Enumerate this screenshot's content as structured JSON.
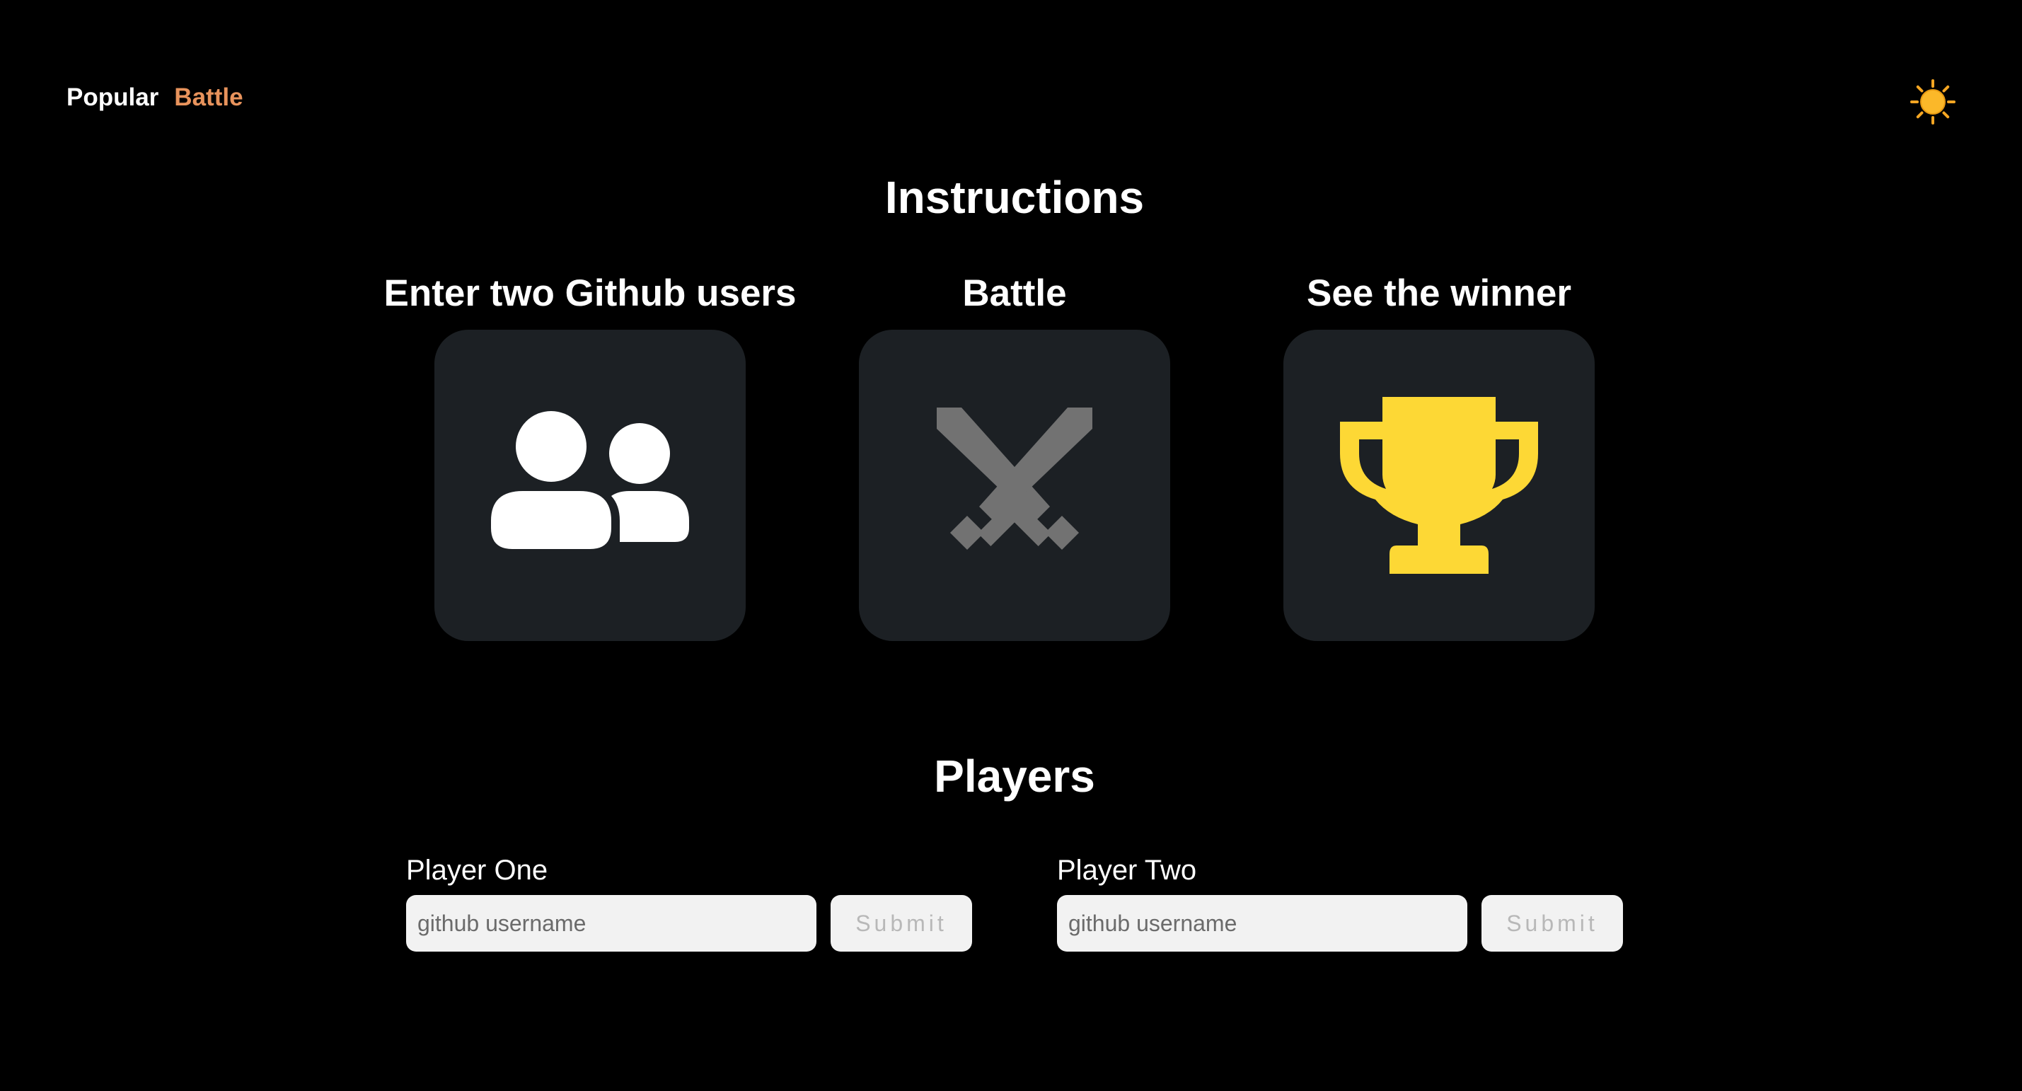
{
  "nav": {
    "items": [
      {
        "label": "Popular",
        "color": "#ffffff"
      },
      {
        "label": "Battle",
        "color": "#e8935c"
      }
    ],
    "theme_toggle_icon": "sun-icon"
  },
  "instructions": {
    "heading": "Instructions",
    "steps": [
      {
        "label": "Enter two Github users",
        "icon": "users-icon",
        "icon_color": "#ffffff"
      },
      {
        "label": "Battle",
        "icon": "crossed-swords-icon",
        "icon_color": "#727272"
      },
      {
        "label": "See the winner",
        "icon": "trophy-icon",
        "icon_color": "#fdd835"
      }
    ],
    "card_color": "#1c2024"
  },
  "players": {
    "heading": "Players",
    "forms": [
      {
        "label": "Player One",
        "placeholder": "github username",
        "value": "",
        "submit_label": "Submit"
      },
      {
        "label": "Player Two",
        "placeholder": "github username",
        "value": "",
        "submit_label": "Submit"
      }
    ]
  }
}
